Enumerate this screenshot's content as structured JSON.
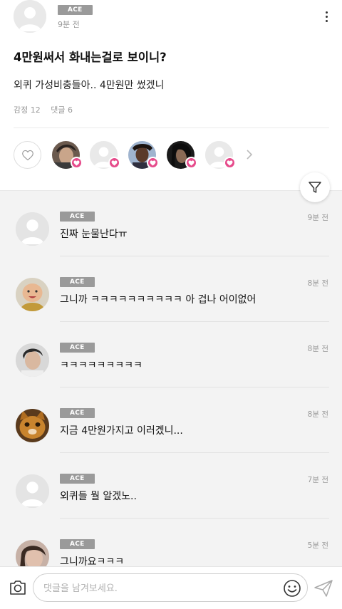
{
  "post": {
    "author_badge": "ACE",
    "time": "9분 전",
    "title": "4만원써서 화내는걸로 보이니?",
    "body": "외퀴 가성비충들아.. 4만원만 썼겠니",
    "stats": {
      "likes": "감정 12",
      "comments": "댓글 6"
    },
    "reactors": [
      {
        "icon": "user-photo-icon"
      },
      {
        "icon": "default-avatar-icon"
      },
      {
        "icon": "user-photo-icon"
      },
      {
        "icon": "user-photo-icon"
      },
      {
        "icon": "default-avatar-icon"
      }
    ],
    "heart_color": "#e64b8b"
  },
  "comments": [
    {
      "badge": "ACE",
      "time": "9분 전",
      "text": "진짜 눈물난다ㅠ",
      "avatar": "default-avatar-icon"
    },
    {
      "badge": "ACE",
      "time": "8분 전",
      "text": "그니까 ㅋㅋㅋㅋㅋㅋㅋㅋㅋㅋ 아 겁나 어이없어",
      "avatar": "cartoon-avatar-icon"
    },
    {
      "badge": "ACE",
      "time": "8분 전",
      "text": "ㅋㅋㅋㅋㅋㅋㅋㅋㅋ",
      "avatar": "user-photo-icon"
    },
    {
      "badge": "ACE",
      "time": "8분 전",
      "text": "지금 4만원가지고 이러겠니...",
      "avatar": "cat-photo-icon"
    },
    {
      "badge": "ACE",
      "time": "7분 전",
      "text": "외퀴들 뭘 알겠노..",
      "avatar": "default-avatar-icon"
    },
    {
      "badge": "ACE",
      "time": "5분 전",
      "text": "그니까요ㅋㅋㅋ",
      "avatar": "user-photo-icon"
    }
  ],
  "input": {
    "placeholder": "댓글을 남겨보세요."
  }
}
